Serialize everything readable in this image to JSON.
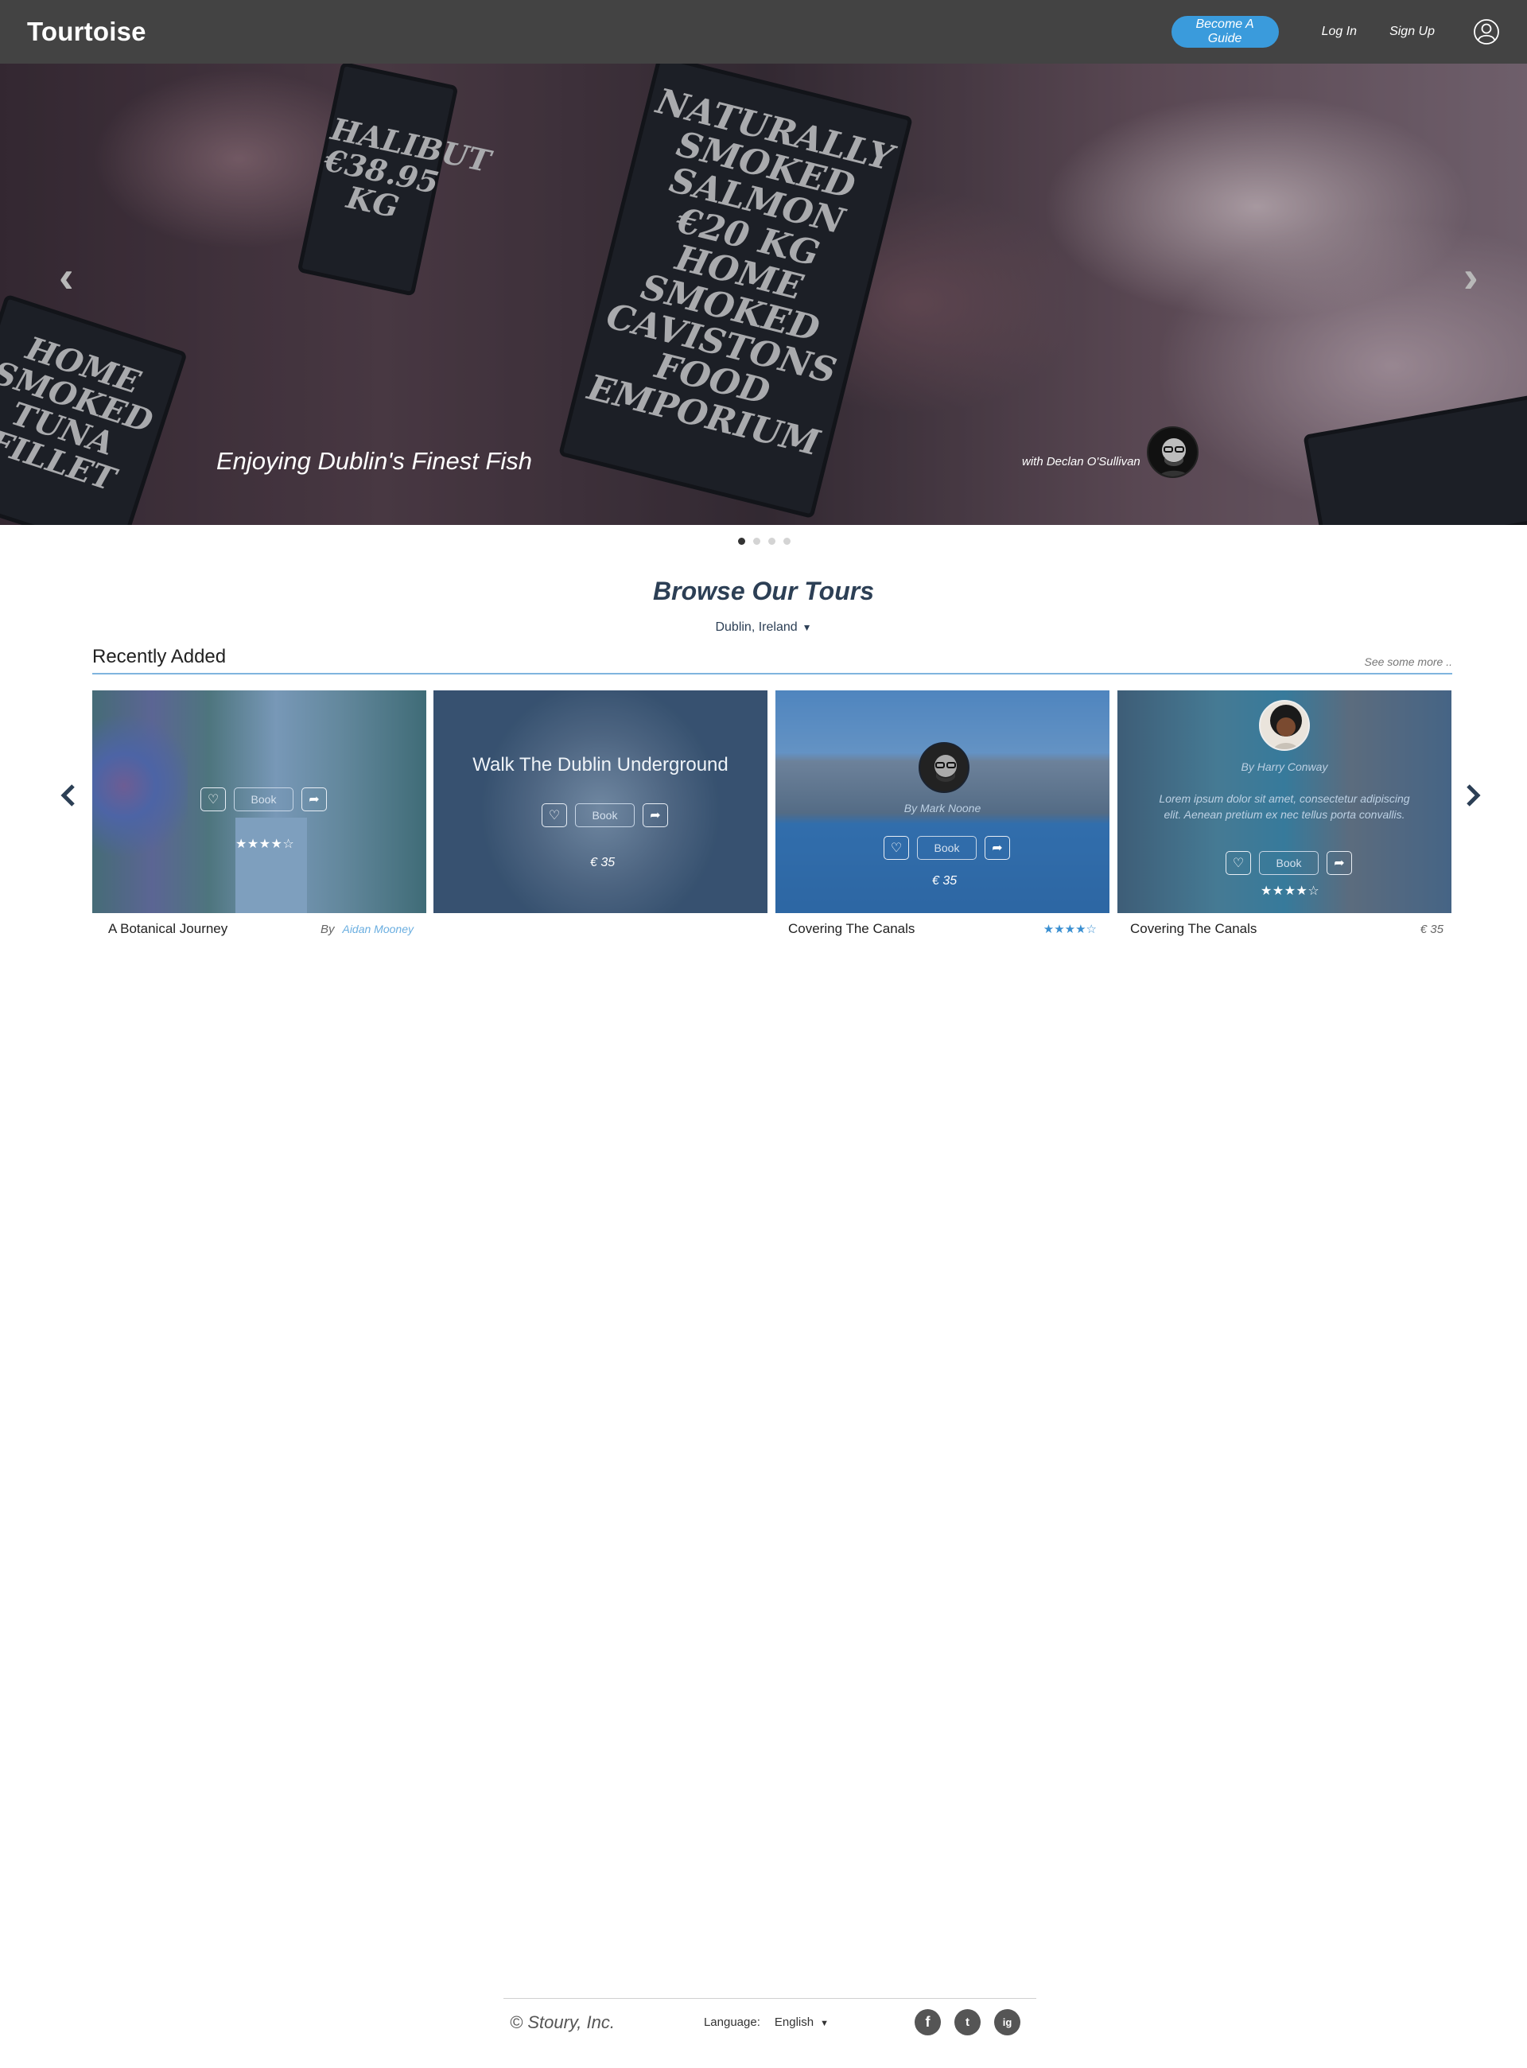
{
  "header": {
    "logo": "Tourtoise",
    "become_guide": "Become A Guide",
    "login": "Log In",
    "signup": "Sign Up",
    "user_icon": "user-circle-icon"
  },
  "hero": {
    "caption": "Enjoying Dublin's Finest Fish",
    "guide_text": "with Declan O'Sullivan",
    "prev_arrow": "‹",
    "next_arrow": "›",
    "signs": {
      "main": "NATURALLY\nSMOKED\nSALMON\n€20 KG\nHOME SMOKED\nCAVISTONS\nFOOD EMPORIUM",
      "left_top": "HALIBUT\n€38.95\nKG",
      "left_bottom": "HOME\nSMOKED\nTUNA\nFILLET"
    },
    "dots": 4,
    "active_dot": 0
  },
  "browse": {
    "title": "Browse Our Tours",
    "location": "Dublin, Ireland",
    "section_title": "Recently Added",
    "see_more": "See some more .."
  },
  "cards": [
    {
      "below_title": "A Botanical Journey",
      "by": "By",
      "author": "Aidan Mooney",
      "book": "Book",
      "stars": "★★★★☆"
    },
    {
      "overlay_title": "Walk The Dublin Underground",
      "book": "Book",
      "price": "€ 35"
    },
    {
      "below_title": "Covering The Canals",
      "byline": "By  Mark Noone",
      "book": "Book",
      "price": "€ 35",
      "stars_below": "★★★★☆"
    },
    {
      "below_title": "Covering The Canals",
      "byline": "By  Harry Conway",
      "lorem": "Lorem ipsum dolor sit amet, consectetur adipiscing elit. Aenean pretium ex nec tellus porta convallis.",
      "book": "Book",
      "stars": "★★★★☆",
      "price_below": "€ 35"
    }
  ],
  "footer": {
    "copyright": "©  Stoury, Inc.",
    "language_label": "Language:",
    "language_value": "English",
    "socials": [
      "f",
      "t",
      "ig"
    ]
  },
  "colors": {
    "header_bg": "#434343",
    "accent": "#3a9bdc",
    "heading": "#2c3f55",
    "card_overlay": "#346eaa"
  }
}
